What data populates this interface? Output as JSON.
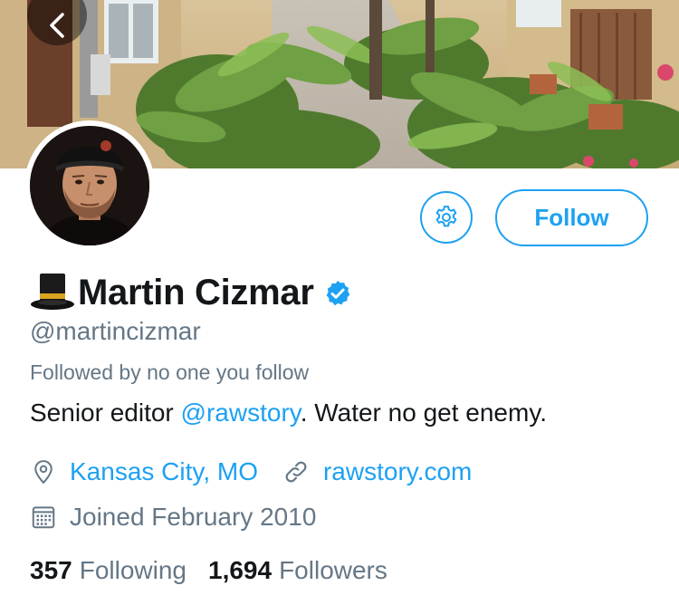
{
  "header": {
    "back_icon": "chevron-left-icon",
    "banner_alt": "garden courtyard with ferns"
  },
  "profile": {
    "name_emoji_icon": "top-hat-icon",
    "display_name": "Martin Cizmar",
    "verified_icon": "verified-badge-icon",
    "handle": "@martincizmar",
    "followed_by": "Followed by no one you follow",
    "bio_prefix": "Senior editor ",
    "bio_mention": "@rawstory",
    "bio_suffix": ". Water no get enemy.",
    "location": "Kansas City, MO",
    "website": "rawstory.com",
    "joined": "Joined February 2010"
  },
  "actions": {
    "settings_icon": "gear-icon",
    "follow_label": "Follow"
  },
  "stats": {
    "following_count": "357",
    "following_label": "Following",
    "followers_count": "1,694",
    "followers_label": "Followers"
  },
  "colors": {
    "accent": "#1da1f2",
    "secondary_text": "#657786",
    "primary_text": "#14171a"
  }
}
